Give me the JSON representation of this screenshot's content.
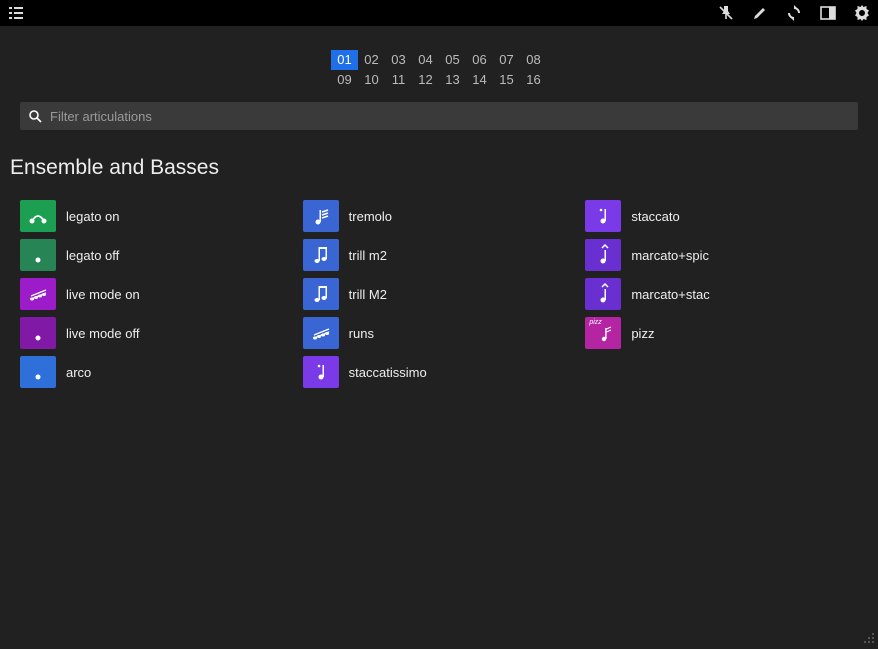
{
  "toolbar": {
    "menu_icon": "list-icon",
    "mute_icon": "bell-off-icon",
    "edit_icon": "pencil-icon",
    "sync_icon": "sync-icon",
    "panels_icon": "panels-icon",
    "settings_icon": "gear-icon"
  },
  "channels": {
    "row1": [
      "01",
      "02",
      "03",
      "04",
      "05",
      "06",
      "07",
      "08"
    ],
    "row2": [
      "09",
      "10",
      "11",
      "12",
      "13",
      "14",
      "15",
      "16"
    ],
    "selected": "01"
  },
  "filter": {
    "placeholder": "Filter articulations"
  },
  "section_title": "Ensemble and Basses",
  "articulations": {
    "col1": [
      {
        "label": "legato on",
        "color": "c-green",
        "icon": "legato"
      },
      {
        "label": "legato off",
        "color": "c-dgreen",
        "icon": "dot"
      },
      {
        "label": "live mode on",
        "color": "c-purple",
        "icon": "runs"
      },
      {
        "label": "live mode off",
        "color": "c-dpurple",
        "icon": "dot"
      },
      {
        "label": "arco",
        "color": "c-blue",
        "icon": "dot"
      }
    ],
    "col2": [
      {
        "label": "tremolo",
        "color": "c-mblue",
        "icon": "tremolo"
      },
      {
        "label": "trill m2",
        "color": "c-mblue",
        "icon": "trill"
      },
      {
        "label": "trill M2",
        "color": "c-mblue",
        "icon": "trill"
      },
      {
        "label": "runs",
        "color": "c-mblue",
        "icon": "runs"
      },
      {
        "label": "staccatissimo",
        "color": "c-violet",
        "icon": "stacc"
      }
    ],
    "col3": [
      {
        "label": "staccato",
        "color": "c-violet",
        "icon": "stacc"
      },
      {
        "label": "marcato+spic",
        "color": "c-dviolet",
        "icon": "marcato"
      },
      {
        "label": "marcato+stac",
        "color": "c-dviolet",
        "icon": "marcato"
      },
      {
        "label": "pizz",
        "color": "c-magenta",
        "icon": "pizz"
      }
    ]
  }
}
